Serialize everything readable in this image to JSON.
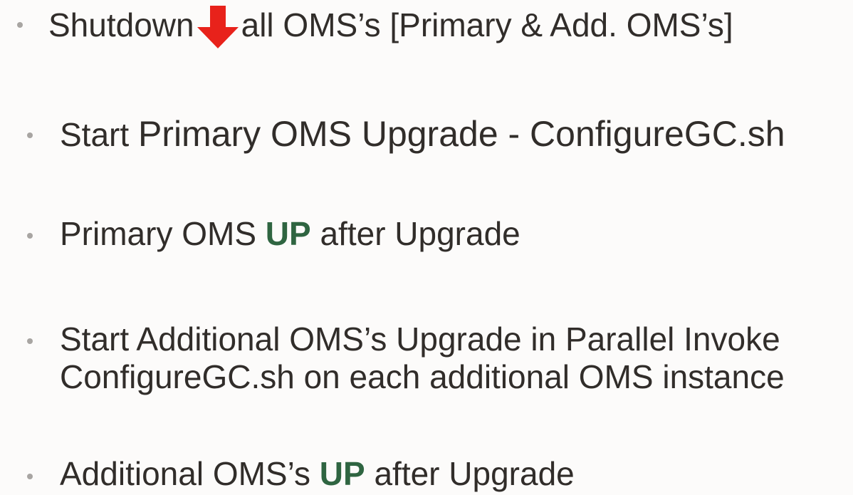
{
  "bullets": {
    "item1": {
      "before": "Shutdown",
      "icon": "down-arrow-icon",
      "icon_color": "#e8221b",
      "after": "all OMS’s [Primary & Add. OMS’s]"
    },
    "item2": {
      "lead": "Start ",
      "main": "Primary OMS Upgrade - ConfigureGC.sh"
    },
    "item3": {
      "before": "Primary OMS ",
      "accent": "UP",
      "after": " after Upgrade"
    },
    "item4": {
      "line1": "Start Additional OMS’s Upgrade in Parallel Invoke",
      "line2": "ConfigureGC.sh on each additional OMS instance"
    },
    "item5": {
      "before": "Additional OMS’s ",
      "accent": "UP",
      "after": " after Upgrade"
    }
  },
  "colors": {
    "background": "#fcfbfa",
    "text": "#312d2a",
    "accent": "#2f6541",
    "bullet": "#a8a5a2"
  }
}
